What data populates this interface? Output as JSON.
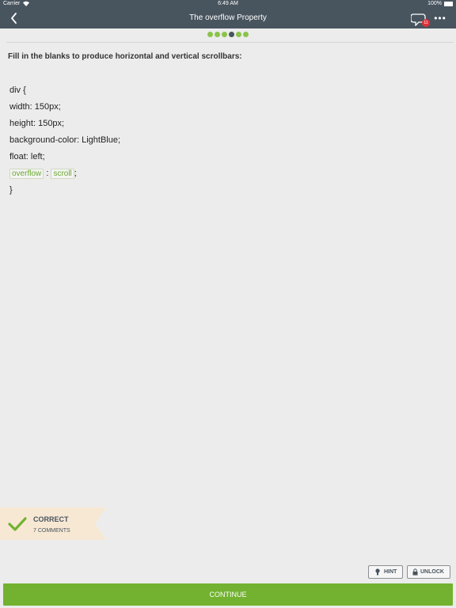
{
  "status_bar": {
    "carrier": "Carrier",
    "time": "6:49 AM",
    "battery": "100%"
  },
  "nav": {
    "title": "The overflow Property",
    "comment_badge": "11",
    "more": "•••"
  },
  "progress": {
    "total": 6,
    "current_index": 3
  },
  "question": {
    "prompt": "Fill in the blanks to produce horizontal and vertical scrollbars:"
  },
  "code": {
    "line1": "div {",
    "line2": "width: 150px;",
    "line3": "height: 150px;",
    "line4": "background-color: LightBlue;",
    "line5": "float: left;",
    "blank1": "overflow",
    "sep": ":",
    "blank2": "scroll",
    "end": ";",
    "close": "}"
  },
  "result": {
    "status": "CORRECT",
    "comments": "7 COMMENTS"
  },
  "actions": {
    "hint": "HINT",
    "unlock": "UNLOCK",
    "continue": "CONTINUE"
  },
  "colors": {
    "header": "#48545e",
    "accent": "#72b230",
    "correct_banner": "#f7e8d4",
    "badge": "#e2303a"
  }
}
